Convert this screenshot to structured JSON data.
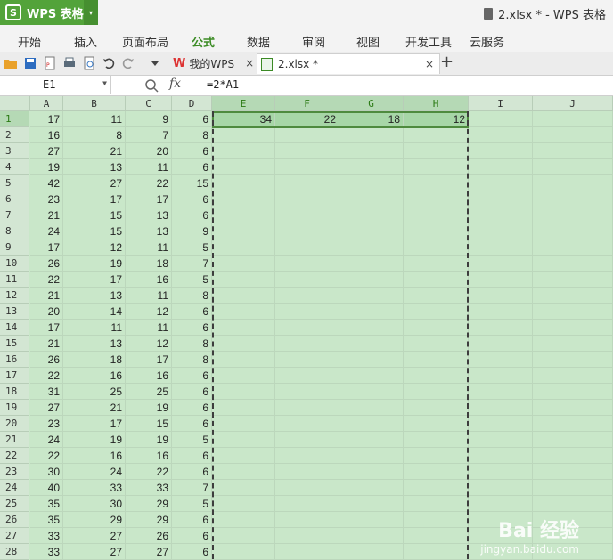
{
  "app": {
    "name": "WPS 表格",
    "logo_letter": "S"
  },
  "window_title": "2.xlsx * - WPS 表格",
  "menu": [
    "开始",
    "插入",
    "页面布局",
    "公式",
    "数据",
    "审阅",
    "视图",
    "开发工具",
    "云服务"
  ],
  "active_menu_index": 3,
  "tabs": [
    {
      "label": "我的WPS",
      "icon": "wps-icon"
    },
    {
      "label": "2.xlsx *",
      "icon": "spreadsheet-icon"
    }
  ],
  "formula_bar": {
    "name_box": "E1",
    "fx_label": "fx",
    "formula": "=2*A1"
  },
  "columns": [
    "A",
    "B",
    "C",
    "D",
    "E",
    "F",
    "G",
    "H",
    "I",
    "J"
  ],
  "rows": [
    [
      17,
      11,
      9,
      6
    ],
    [
      16,
      8,
      7,
      8
    ],
    [
      27,
      21,
      20,
      6
    ],
    [
      19,
      13,
      11,
      6
    ],
    [
      42,
      27,
      22,
      15
    ],
    [
      23,
      17,
      17,
      6
    ],
    [
      21,
      15,
      13,
      6
    ],
    [
      24,
      15,
      13,
      9
    ],
    [
      17,
      12,
      11,
      5
    ],
    [
      26,
      19,
      18,
      7
    ],
    [
      22,
      17,
      16,
      5
    ],
    [
      21,
      13,
      11,
      8
    ],
    [
      20,
      14,
      12,
      6
    ],
    [
      17,
      11,
      11,
      6
    ],
    [
      21,
      13,
      12,
      8
    ],
    [
      26,
      18,
      17,
      8
    ],
    [
      22,
      16,
      16,
      6
    ],
    [
      31,
      25,
      25,
      6
    ],
    [
      27,
      21,
      19,
      6
    ],
    [
      23,
      17,
      15,
      6
    ],
    [
      24,
      19,
      19,
      5
    ],
    [
      22,
      16,
      16,
      6
    ],
    [
      30,
      24,
      22,
      6
    ],
    [
      40,
      33,
      33,
      7
    ],
    [
      35,
      30,
      29,
      5
    ],
    [
      35,
      29,
      29,
      6
    ],
    [
      33,
      27,
      26,
      6
    ],
    [
      33,
      27,
      27,
      6
    ]
  ],
  "computed_row1": [
    34,
    22,
    18,
    12
  ],
  "selected_columns": [
    "E",
    "F",
    "G",
    "H"
  ],
  "selected_row": 1,
  "watermark": {
    "main": "Bai 经验",
    "sub": "jingyan.baidu.com"
  },
  "colors": {
    "brand_green": "#53a33a",
    "grid_bg": "#c9e7c9",
    "selection": "#a7d6a7"
  }
}
